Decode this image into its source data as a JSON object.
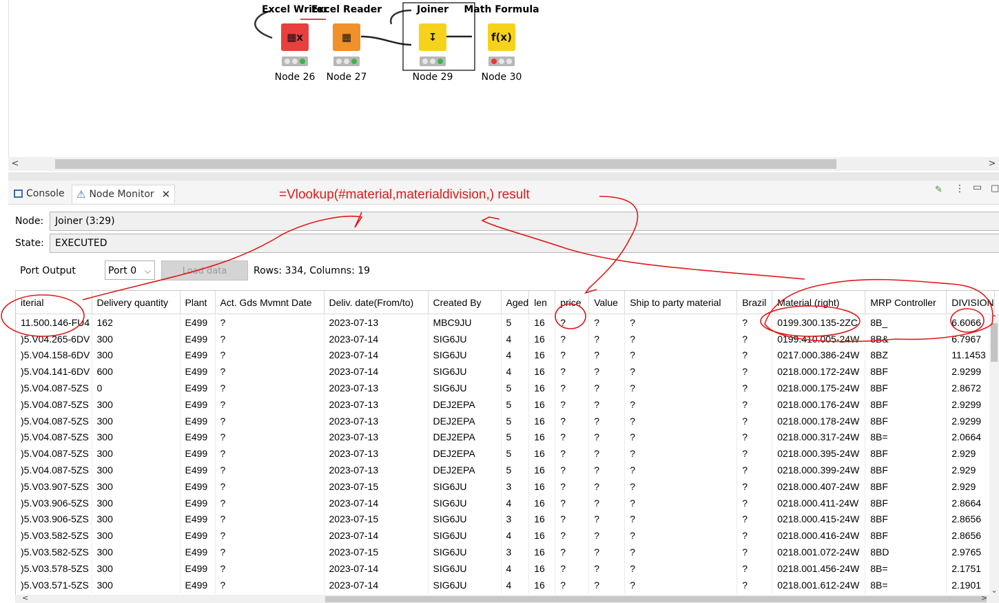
{
  "workflow": {
    "nodes": [
      {
        "title": "Excel Writer",
        "label": "Node 26",
        "color": "#e8403e",
        "icon_glyph": "▦x",
        "icon": "excel-writer-icon",
        "status": "ok"
      },
      {
        "title": "Excel Reader",
        "label": "Node 27",
        "color": "#f0912a",
        "icon_glyph": "▦",
        "icon": "excel-reader-icon",
        "status": "ok"
      },
      {
        "title": "Joiner",
        "label": "Node 29",
        "color": "#f7d21b",
        "icon_glyph": "↧",
        "icon": "joiner-icon",
        "status": "ok"
      },
      {
        "title": "Math Formula",
        "label": "Node 30",
        "color": "#f7d21b",
        "icon_glyph": "f(x)",
        "icon": "math-formula-icon",
        "status": "warning"
      }
    ]
  },
  "tabs": [
    {
      "label": "Console",
      "icon": "console-icon",
      "active": false
    },
    {
      "label": "Node Monitor",
      "icon": "node-monitor-icon",
      "active": true
    }
  ],
  "annotation": "=Vlookup(#material,materialdivision,) result",
  "node_field": {
    "label": "Node:",
    "value": "Joiner  (3:29)"
  },
  "state_field": {
    "label": "State:",
    "value": "EXECUTED"
  },
  "port": {
    "label": "Port Output",
    "selected": "Port 0",
    "load_label": "Load data",
    "rows_info": "Rows: 334, Columns: 19"
  },
  "table": {
    "columns": [
      "iterial",
      "Delivery quantity",
      "Plant",
      "Act. Gds Mvmnt Date",
      "Deliv. date(From/to)",
      "Created By",
      "Aged",
      "len",
      "price",
      "Value",
      "Ship to party  material",
      "Brazil",
      "Material (right)",
      "MRP Controller",
      "DIVISION"
    ],
    "rows": [
      [
        "11.500.146-FU4",
        "162",
        "E499",
        "?",
        "2023-07-13",
        "MBC9JU",
        "5",
        "16",
        "?",
        "?",
        "?",
        "?",
        "0199.300.135-2ZC",
        "8B_",
        "6.6066"
      ],
      [
        ")5.V04.265-6DV",
        "300",
        "E499",
        "?",
        "2023-07-14",
        "SIG6JU",
        "4",
        "16",
        "?",
        "?",
        "?",
        "?",
        "0199.410.005-24W",
        "8B&",
        "6.7967"
      ],
      [
        ")5.V04.158-6DV",
        "300",
        "E499",
        "?",
        "2023-07-14",
        "SIG6JU",
        "4",
        "16",
        "?",
        "?",
        "?",
        "?",
        "0217.000.386-24W",
        "8BZ",
        "11.1453"
      ],
      [
        ")5.V04.141-6DV",
        "600",
        "E499",
        "?",
        "2023-07-14",
        "SIG6JU",
        "4",
        "16",
        "?",
        "?",
        "?",
        "?",
        "0218.000.172-24W",
        "8BF",
        "2.9299"
      ],
      [
        ")5.V04.087-5ZS",
        "0",
        "E499",
        "?",
        "2023-07-13",
        "SIG6JU",
        "5",
        "16",
        "?",
        "?",
        "?",
        "?",
        "0218.000.175-24W",
        "8BF",
        "2.8672"
      ],
      [
        ")5.V04.087-5ZS",
        "300",
        "E499",
        "?",
        "2023-07-13",
        "DEJ2EPA",
        "5",
        "16",
        "?",
        "?",
        "?",
        "?",
        "0218.000.176-24W",
        "8BF",
        "2.9299"
      ],
      [
        ")5.V04.087-5ZS",
        "300",
        "E499",
        "?",
        "2023-07-13",
        "DEJ2EPA",
        "5",
        "16",
        "?",
        "?",
        "?",
        "?",
        "0218.000.178-24W",
        "8BF",
        "2.9299"
      ],
      [
        ")5.V04.087-5ZS",
        "300",
        "E499",
        "?",
        "2023-07-13",
        "DEJ2EPA",
        "5",
        "16",
        "?",
        "?",
        "?",
        "?",
        "0218.000.317-24W",
        "8B=",
        "2.0664"
      ],
      [
        ")5.V04.087-5ZS",
        "300",
        "E499",
        "?",
        "2023-07-13",
        "DEJ2EPA",
        "5",
        "16",
        "?",
        "?",
        "?",
        "?",
        "0218.000.395-24W",
        "8BF",
        "2.929"
      ],
      [
        ")5.V04.087-5ZS",
        "300",
        "E499",
        "?",
        "2023-07-13",
        "DEJ2EPA",
        "5",
        "16",
        "?",
        "?",
        "?",
        "?",
        "0218.000.399-24W",
        "8BF",
        "2.929"
      ],
      [
        ")5.V03.907-5ZS",
        "300",
        "E499",
        "?",
        "2023-07-15",
        "SIG6JU",
        "3",
        "16",
        "?",
        "?",
        "?",
        "?",
        "0218.000.407-24W",
        "8BF",
        "2.929"
      ],
      [
        ")5.V03.906-5ZS",
        "300",
        "E499",
        "?",
        "2023-07-14",
        "SIG6JU",
        "4",
        "16",
        "?",
        "?",
        "?",
        "?",
        "0218.000.411-24W",
        "8BF",
        "2.8664"
      ],
      [
        ")5.V03.906-5ZS",
        "300",
        "E499",
        "?",
        "2023-07-15",
        "SIG6JU",
        "3",
        "16",
        "?",
        "?",
        "?",
        "?",
        "0218.000.415-24W",
        "8BF",
        "2.8656"
      ],
      [
        ")5.V03.582-5ZS",
        "300",
        "E499",
        "?",
        "2023-07-14",
        "SIG6JU",
        "4",
        "16",
        "?",
        "?",
        "?",
        "?",
        "0218.000.416-24W",
        "8BF",
        "2.8656"
      ],
      [
        ")5.V03.582-5ZS",
        "300",
        "E499",
        "?",
        "2023-07-15",
        "SIG6JU",
        "3",
        "16",
        "?",
        "?",
        "?",
        "?",
        "0218.001.072-24W",
        "8BD",
        "2.9765"
      ],
      [
        ")5.V03.578-5ZS",
        "300",
        "E499",
        "?",
        "2023-07-14",
        "SIG6JU",
        "4",
        "16",
        "?",
        "?",
        "?",
        "?",
        "0218.001.456-24W",
        "8B=",
        "2.1751"
      ],
      [
        ")5.V03.571-5ZS",
        "300",
        "E499",
        "?",
        "2023-07-14",
        "SIG6JU",
        "4",
        "16",
        "?",
        "?",
        "?",
        "?",
        "0218.001.612-24W",
        "8B=",
        "2.1901"
      ]
    ]
  },
  "colors": {
    "annotation": "#e01818",
    "selected_node_border": "#000000"
  }
}
